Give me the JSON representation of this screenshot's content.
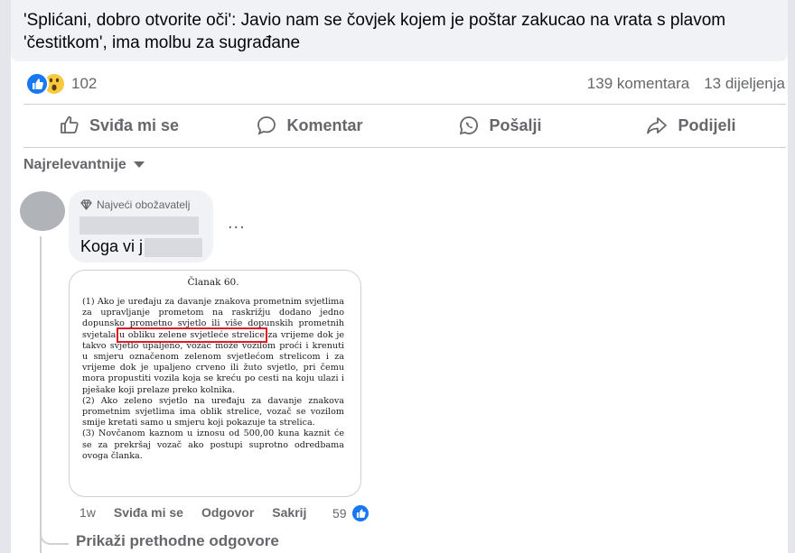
{
  "post": {
    "link_title": "'Splićani, dobro otvorite oči': Javio nam se čovjek kojem je poštar zakucao na vrata s plavom 'čestitkom', ima molbu za sugrađane",
    "reaction_count": "102",
    "comments_count": "139 komentara",
    "shares_count": "13 dijeljenja",
    "reaction_icons": [
      "like-icon",
      "wow-icon"
    ]
  },
  "actions": {
    "like": "Sviđa mi se",
    "comment": "Komentar",
    "send": "Pošalji",
    "share": "Podijeli"
  },
  "sort": {
    "label": "Najrelevantnije"
  },
  "comment": {
    "badge": "Najveći obožavatelj",
    "text": "Koga vi j",
    "time": "1w",
    "like": "Sviđa mi se",
    "reply": "Odgovor",
    "hide": "Sakrij",
    "like_count": "59",
    "more": "...",
    "image": {
      "title": "Članak 60.",
      "p1_before": "(1) Ako je uređaju za davanje znakova prometnim svjetlima za upravljanje prometom na raskrižju dodano jedno dopunsko prometno svjetlo ili više dopunskih prometnih svjetala ",
      "p1_highlight": "u obliku zelene svjetleće strelice",
      "p1_after": " za vrijeme dok je takvo svjetlo upaljeno, vozač može vozilom proći i krenuti u smjeru označenom zelenom svjetlećom strelicom i za vrijeme dok je upaljeno crveno ili žuto svjetlo, pri čemu mora propustiti vozila koja se kreću po cesti na koju ulazi i pješake koji prelaze preko kolnika.",
      "p2": "(2) Ako zeleno svjetlo na uređaju za davanje znakova prometnim svjetlima ima oblik strelice, vozač se vozilom smije kretati samo u smjeru koji pokazuje ta strelica.",
      "p3": "(3) Novčanom kaznom u iznosu od 500,00 kuna kaznit će se za prekršaj vozač ako postupi suprotno odredbama ovoga članka."
    }
  },
  "previous_replies": "Prikaži prethodne odgovore",
  "colors": {
    "accent": "#1877f2",
    "secondary_text": "#65676b",
    "highlight": "#e01b24"
  }
}
